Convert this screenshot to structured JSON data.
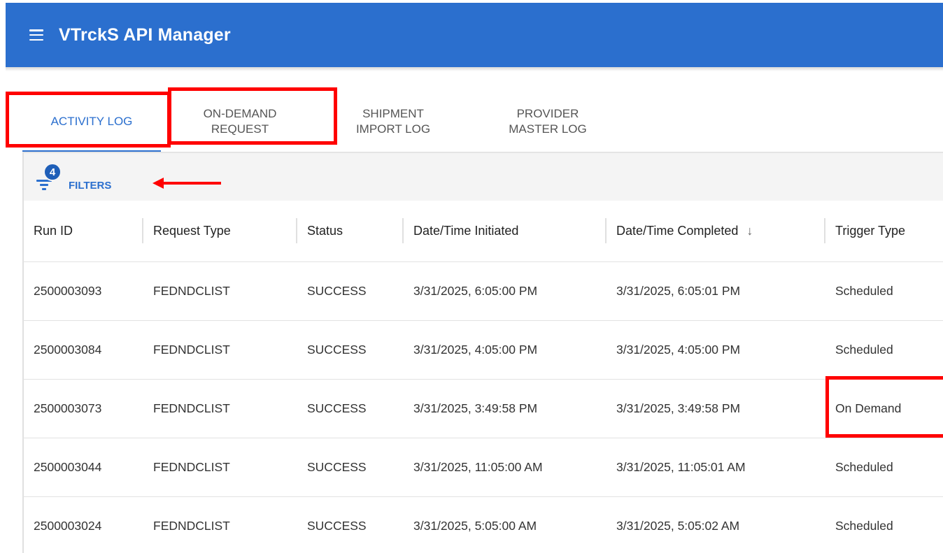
{
  "header": {
    "title": "VTrckS API Manager",
    "menu_icon": "hamburger-menu-icon",
    "background_color": "#2b6fce"
  },
  "tabs": [
    {
      "label": "ACTIVITY LOG",
      "active": true
    },
    {
      "label": "ON-DEMAND\nREQUEST",
      "active": false
    },
    {
      "label": "SHIPMENT\nIMPORT LOG",
      "active": false
    },
    {
      "label": "PROVIDER\nMASTER LOG",
      "active": false
    }
  ],
  "filters": {
    "label": "FILTERS",
    "count": "4",
    "icon": "filter-icon"
  },
  "table": {
    "columns": [
      "Run ID",
      "Request Type",
      "Status",
      "Date/Time Initiated",
      "Date/Time Completed",
      "Trigger Type"
    ],
    "sort_icon": "arrow-down-icon",
    "rows": [
      [
        "2500003093",
        "FEDNDCLIST",
        "SUCCESS",
        "3/31/2025, 6:05:00 PM",
        "3/31/2025, 6:05:01 PM",
        "Scheduled"
      ],
      [
        "2500003084",
        "FEDNDCLIST",
        "SUCCESS",
        "3/31/2025, 4:05:00 PM",
        "3/31/2025, 4:05:00 PM",
        "Scheduled"
      ],
      [
        "2500003073",
        "FEDNDCLIST",
        "SUCCESS",
        "3/31/2025, 3:49:58 PM",
        "3/31/2025, 3:49:58 PM",
        "On Demand"
      ],
      [
        "2500003044",
        "FEDNDCLIST",
        "SUCCESS",
        "3/31/2025, 11:05:00 AM",
        "3/31/2025, 11:05:01 AM",
        "Scheduled"
      ],
      [
        "2500003024",
        "FEDNDCLIST",
        "SUCCESS",
        "3/31/2025, 5:05:00 AM",
        "3/31/2025, 5:05:02 AM",
        "Scheduled"
      ]
    ]
  },
  "annotations": {
    "color": "#ff0000"
  }
}
